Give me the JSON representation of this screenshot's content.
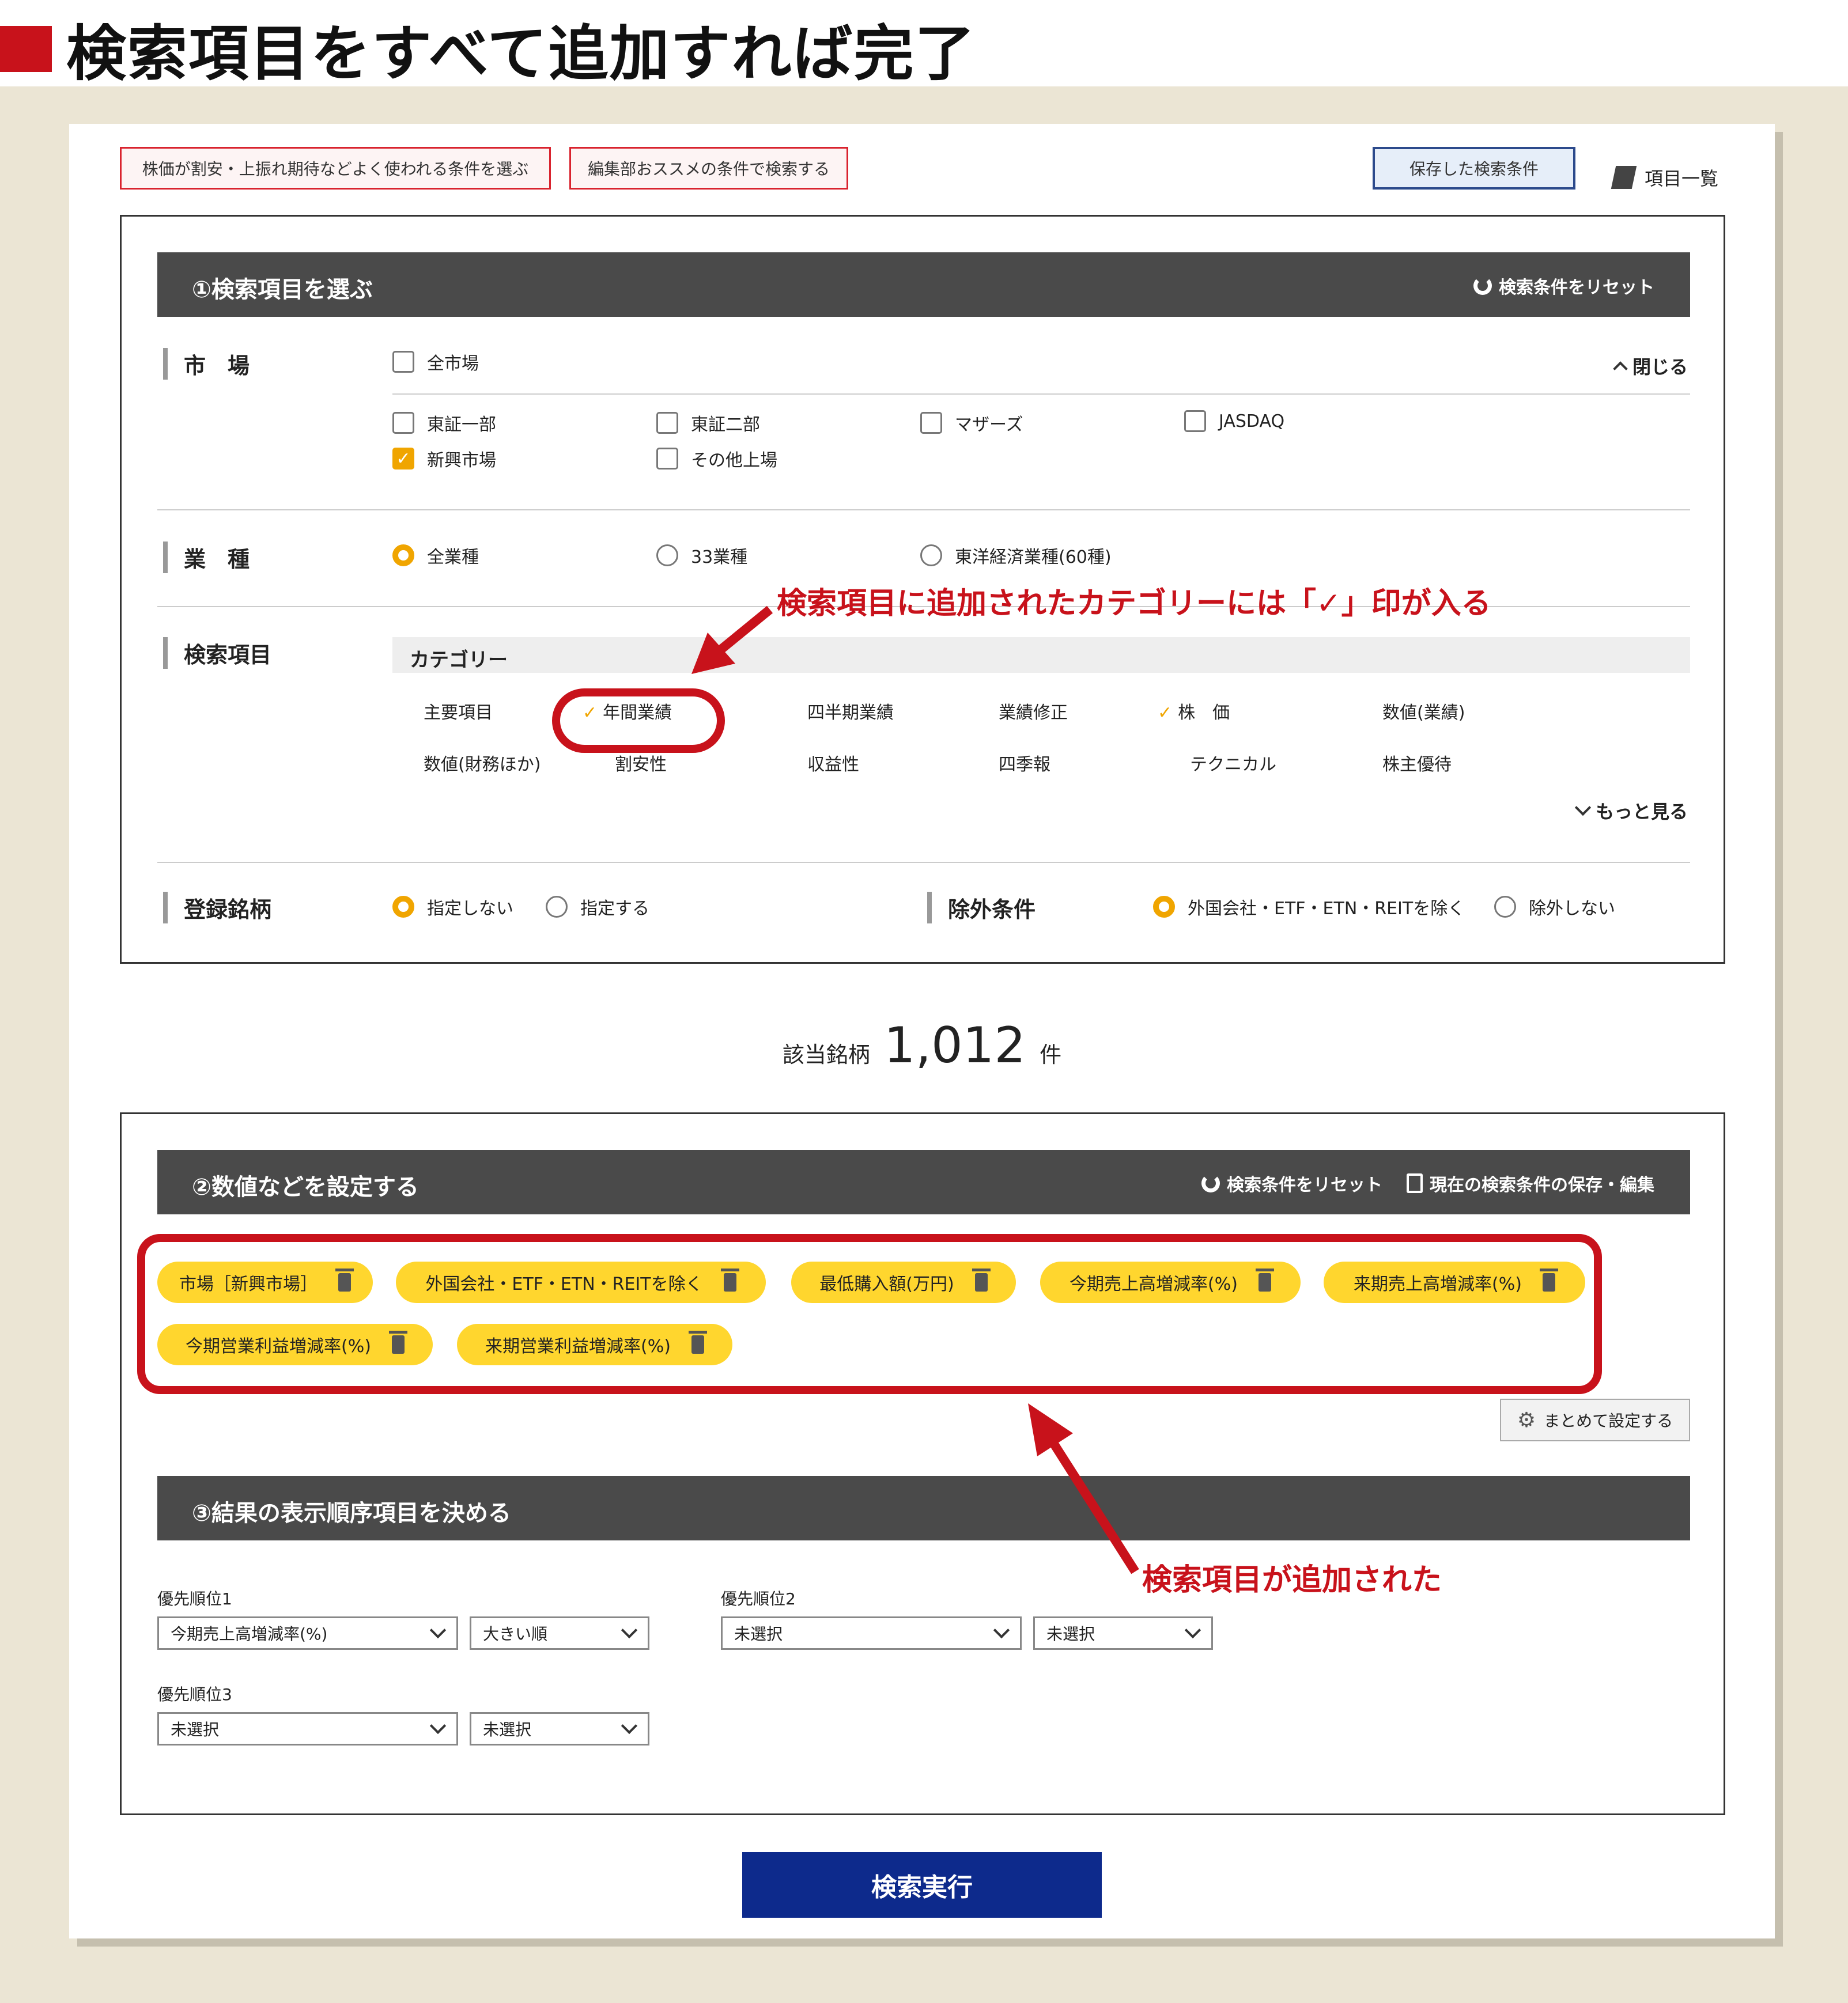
{
  "header": {
    "title": "検索項目をすべて追加すれば完了"
  },
  "top": {
    "preset_btn": "株価が割安・上振れ期待などよく使われる条件を選ぶ",
    "editor_btn": "編集部おススメの条件で検索する",
    "saved_btn": "保存した検索条件",
    "item_list": "項目一覧"
  },
  "s1": {
    "title": "①検索項目を選ぶ",
    "reset": "検索条件をリセット",
    "close": "閉じる",
    "market": {
      "label": "市　場",
      "all": "全市場",
      "items": [
        "東証一部",
        "東証二部",
        "マザーズ",
        "JASDAQ",
        "新興市場",
        "その他上場"
      ],
      "checked": [
        "新興市場"
      ]
    },
    "industry": {
      "label": "業　種",
      "options": [
        "全業種",
        "33業種",
        "東洋経済業種(60種)"
      ],
      "selected": "全業種"
    },
    "search": {
      "label": "検索項目",
      "category": "カテゴリー",
      "items": [
        "主要項目",
        "年間業績",
        "四半期業績",
        "業績修正",
        "株　価",
        "数値(業績)",
        "数値(財務ほか)",
        "割安性",
        "収益性",
        "四季報",
        "テクニカル",
        "株主優待"
      ],
      "checked": [
        "年間業績",
        "株　価"
      ],
      "more": "もっと見る"
    },
    "reg": {
      "label": "登録銘柄",
      "options": [
        "指定しない",
        "指定する"
      ],
      "selected": "指定しない"
    },
    "excl": {
      "label": "除外条件",
      "options": [
        "外国会社・ETF・ETN・REITを除く",
        "除外しない"
      ],
      "selected": "外国会社・ETF・ETN・REITを除く"
    }
  },
  "count": {
    "prefix": "該当銘柄",
    "value": "1,012",
    "suffix": "件"
  },
  "s2": {
    "title": "②数値などを設定する",
    "reset": "検索条件をリセット",
    "save": "現在の検索条件の保存・編集",
    "tags": [
      "市場［新興市場］",
      "外国会社・ETF・ETN・REITを除く",
      "最低購入額(万円)",
      "今期売上高増減率(%)",
      "来期売上高増減率(%)",
      "今期営業利益増減率(%)",
      "来期営業利益増減率(%)"
    ],
    "bulk": "まとめて設定する"
  },
  "s3": {
    "title": "③結果の表示順序項目を決める",
    "p1": {
      "label": "優先順位1",
      "field": "今期売上高増減率(%)",
      "order": "大きい順"
    },
    "p2": {
      "label": "優先順位2",
      "field": "未選択",
      "order": "未選択"
    },
    "p3": {
      "label": "優先順位3",
      "field": "未選択",
      "order": "未選択"
    }
  },
  "run": "検索実行",
  "ann": {
    "a1": "検索項目に追加されたカテゴリーには「✓」印が入る",
    "a2": "検索項目が追加された"
  },
  "colors": {
    "accent_red": "#c8121b",
    "tag_yellow": "#ffd62e",
    "radio_orange": "#f0a500",
    "run_blue": "#0d2a8c"
  }
}
